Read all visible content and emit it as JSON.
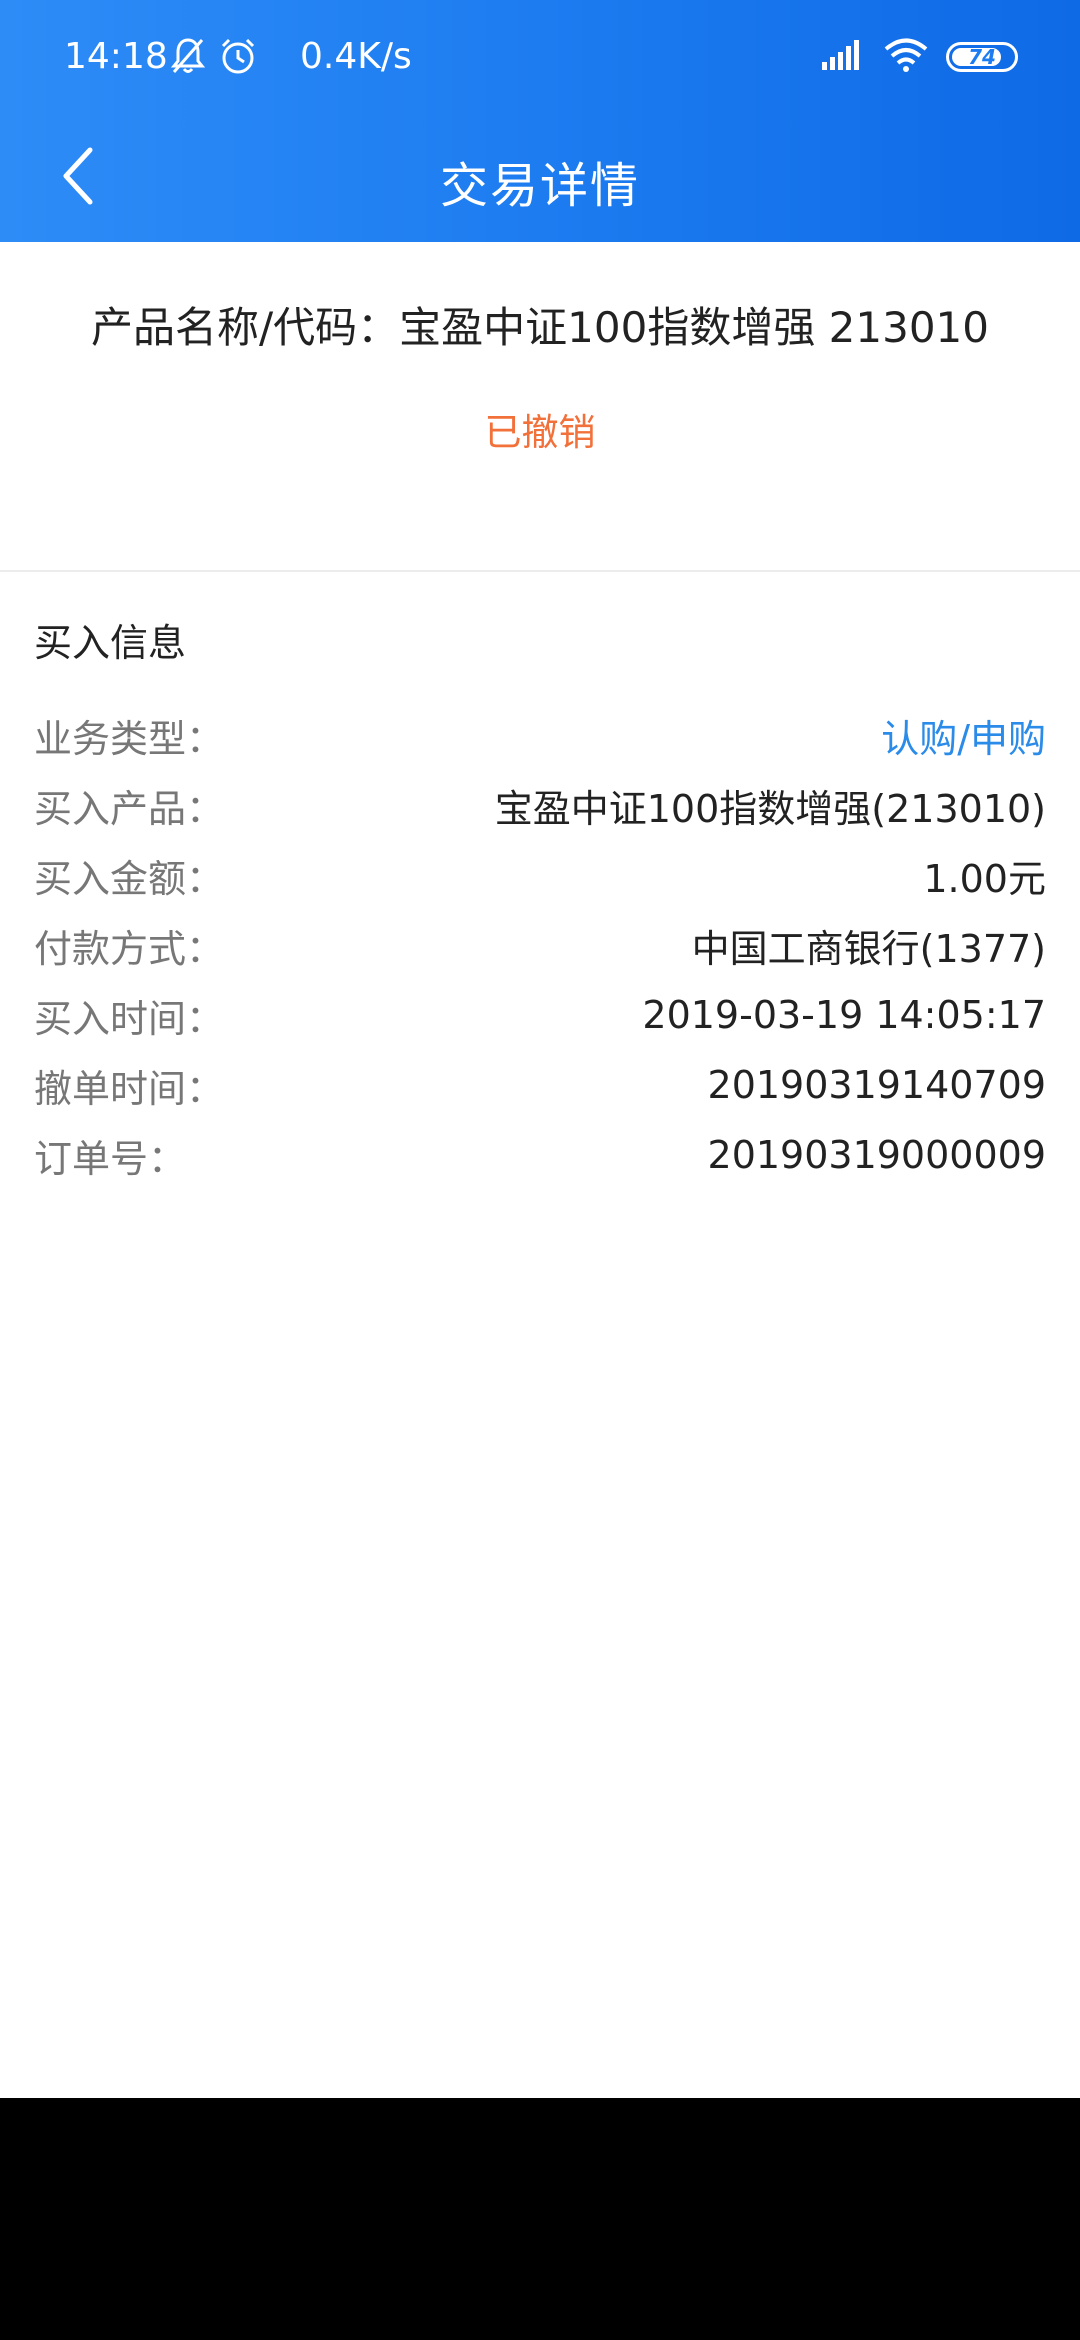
{
  "status_bar": {
    "time": "14:18",
    "speed": "0.4K/s",
    "battery": "74",
    "icons": [
      "bell-off-icon",
      "alarm-icon",
      "signal-icon",
      "wifi-icon",
      "battery-icon"
    ]
  },
  "nav": {
    "title": "交易详情",
    "back_icon": "chevron-left-icon"
  },
  "product": {
    "line": "产品名称/代码：宝盈中证100指数增强 213010",
    "status": "已撤销"
  },
  "info": {
    "heading": "买入信息",
    "rows": [
      {
        "label": "业务类型：",
        "value": "认购/申购"
      },
      {
        "label": "买入产品：",
        "value": "宝盈中证100指数增强(213010)"
      },
      {
        "label": "买入金额：",
        "value": "1.00元"
      },
      {
        "label": "付款方式：",
        "value": "中国工商银行(1377)"
      },
      {
        "label": "买入时间：",
        "value": "2019-03-19 14:05:17"
      },
      {
        "label": "撤单时间：",
        "value": "20190319140709"
      },
      {
        "label": "订单号：",
        "value": "20190319000009"
      }
    ]
  },
  "colors": {
    "header_blue": "#1d7cf0",
    "status_orange": "#f2703a",
    "link_blue": "#2b8be8"
  }
}
